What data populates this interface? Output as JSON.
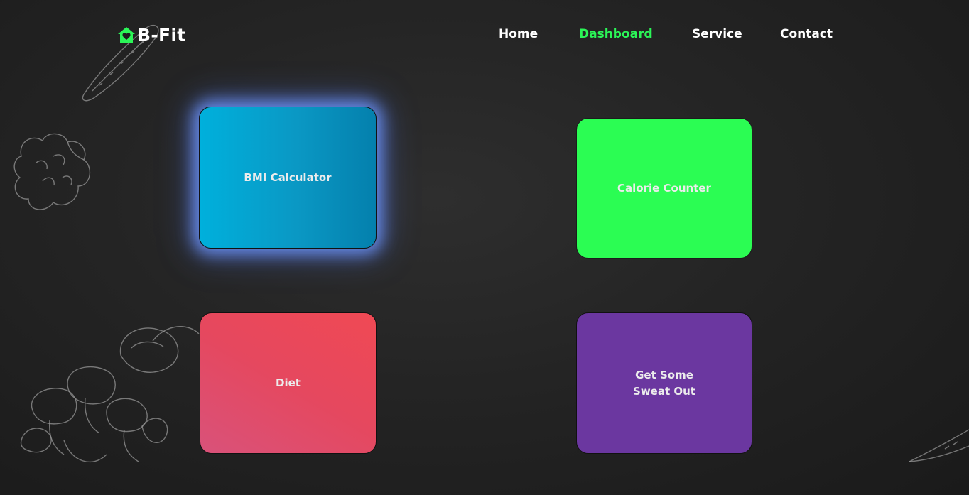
{
  "brand": {
    "name": "B-Fit",
    "icon": "home-heart-icon",
    "accent_color": "#2bf657"
  },
  "nav": {
    "items": [
      {
        "label": "Home",
        "active": false
      },
      {
        "label": "Dashboard",
        "active": true
      },
      {
        "label": "Service",
        "active": false
      },
      {
        "label": "Contact",
        "active": false
      }
    ]
  },
  "cards": {
    "bmi": {
      "label": "BMI Calculator",
      "colors": [
        "#00b0dc",
        "#0480ad"
      ]
    },
    "calorie": {
      "label": "Calorie Counter",
      "color": "#2bfd53"
    },
    "diet": {
      "label": "Diet",
      "colors": [
        "#d9527a",
        "#f04954"
      ]
    },
    "sweat": {
      "line1": "Get Some",
      "line2": "Sweat Out",
      "color": "#6b37a0"
    }
  }
}
